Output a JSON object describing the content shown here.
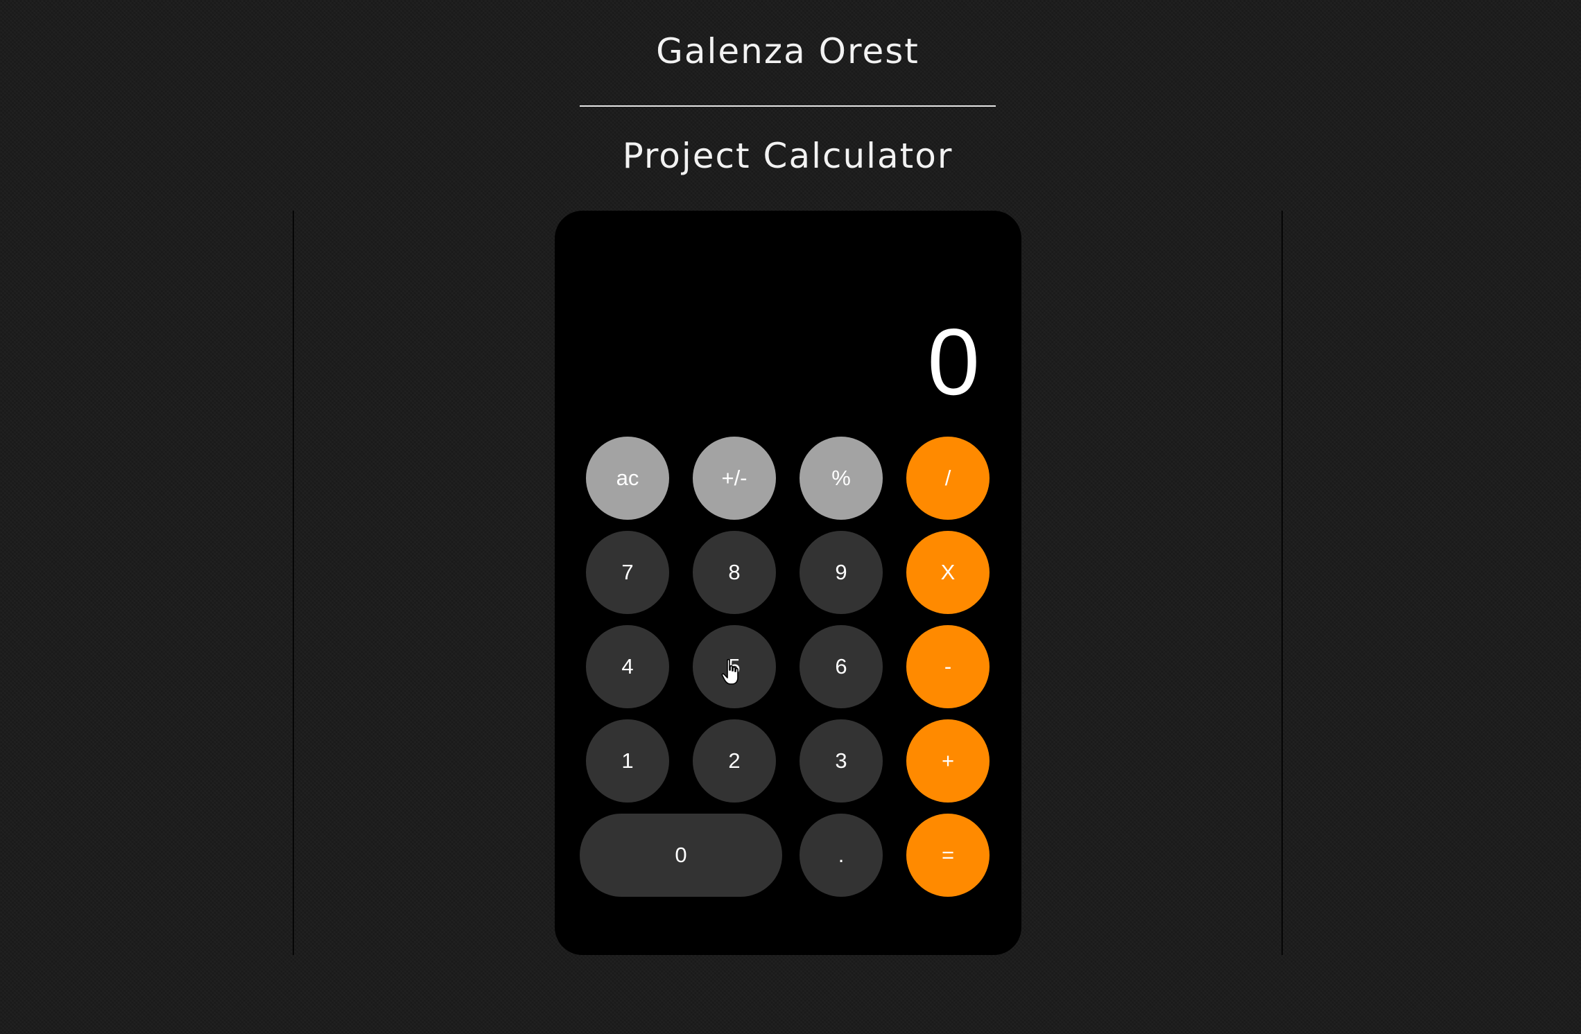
{
  "header": {
    "author": "Galenza Orest",
    "title": "Project Calculator"
  },
  "calculator": {
    "display": "0",
    "rows": [
      [
        {
          "name": "ac-button",
          "label": "ac",
          "kind": "fn"
        },
        {
          "name": "plus-minus-button",
          "label": "+/-",
          "kind": "fn"
        },
        {
          "name": "percent-button",
          "label": "%",
          "kind": "fn"
        },
        {
          "name": "divide-button",
          "label": "/",
          "kind": "op"
        }
      ],
      [
        {
          "name": "digit-7-button",
          "label": "7",
          "kind": "num"
        },
        {
          "name": "digit-8-button",
          "label": "8",
          "kind": "num"
        },
        {
          "name": "digit-9-button",
          "label": "9",
          "kind": "num"
        },
        {
          "name": "multiply-button",
          "label": "X",
          "kind": "op"
        }
      ],
      [
        {
          "name": "digit-4-button",
          "label": "4",
          "kind": "num"
        },
        {
          "name": "digit-5-button",
          "label": "5",
          "kind": "num"
        },
        {
          "name": "digit-6-button",
          "label": "6",
          "kind": "num"
        },
        {
          "name": "subtract-button",
          "label": "-",
          "kind": "op"
        }
      ],
      [
        {
          "name": "digit-1-button",
          "label": "1",
          "kind": "num"
        },
        {
          "name": "digit-2-button",
          "label": "2",
          "kind": "num"
        },
        {
          "name": "digit-3-button",
          "label": "3",
          "kind": "num"
        },
        {
          "name": "add-button",
          "label": "+",
          "kind": "op"
        }
      ],
      [
        {
          "name": "digit-0-button",
          "label": "0",
          "kind": "num",
          "wide": true
        },
        {
          "name": "decimal-button",
          "label": ".",
          "kind": "num"
        },
        {
          "name": "equals-button",
          "label": "=",
          "kind": "op"
        }
      ]
    ]
  },
  "colors": {
    "function_key": "#a3a3a3",
    "number_key": "#333333",
    "operator_key": "#ff8a00",
    "calculator_body": "#000000",
    "page_background": "#1d1d1d"
  },
  "icons": {
    "cursor": "hand-pointer-icon"
  }
}
